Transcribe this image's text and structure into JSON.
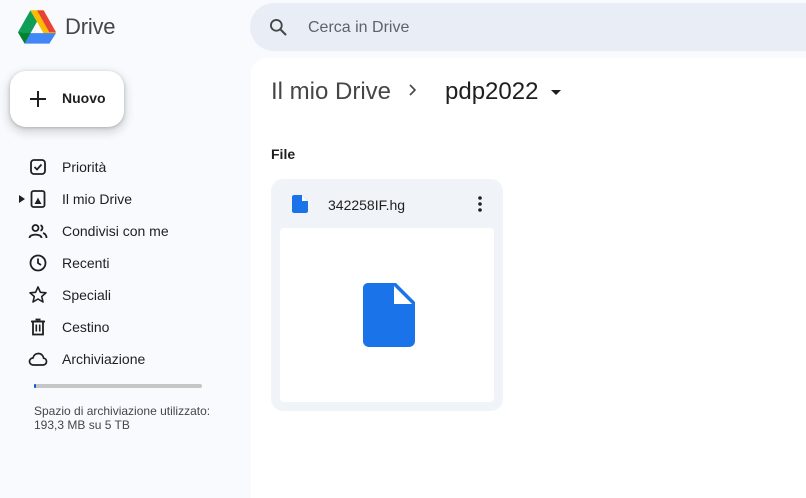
{
  "app": {
    "name": "Drive"
  },
  "search": {
    "placeholder": "Cerca in Drive"
  },
  "sidebar": {
    "new_label": "Nuovo",
    "items": [
      {
        "label": "Priorità",
        "icon": "check-circle-icon"
      },
      {
        "label": "Il mio Drive",
        "icon": "my-drive-icon"
      },
      {
        "label": "Condivisi con me",
        "icon": "people-icon"
      },
      {
        "label": "Recenti",
        "icon": "clock-icon"
      },
      {
        "label": "Speciali",
        "icon": "star-icon"
      },
      {
        "label": "Cestino",
        "icon": "trash-icon"
      },
      {
        "label": "Archiviazione",
        "icon": "cloud-icon"
      }
    ],
    "storage": {
      "text": "Spazio di archiviazione utilizzato: 193,3 MB su 5 TB",
      "used_fraction": 0.01
    }
  },
  "breadcrumb": {
    "root": "Il mio Drive",
    "current": "pdp2022"
  },
  "section": {
    "title": "File"
  },
  "files": [
    {
      "name": "342258IF.hg",
      "icon": "file-icon"
    }
  ],
  "colors": {
    "accent": "#0b57d0",
    "file_blue": "#1a73e8",
    "search_bg": "#e9eef6",
    "sidebar_bg": "#f8fafd",
    "card_bg": "#f0f4f9"
  }
}
